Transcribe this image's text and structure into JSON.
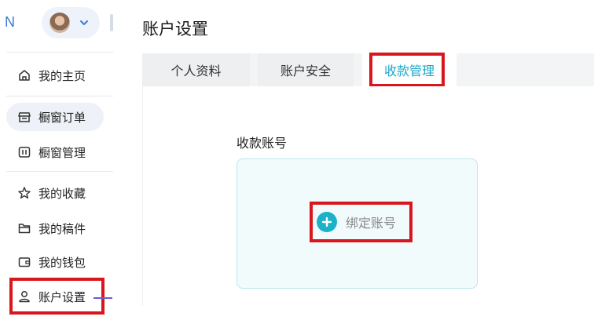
{
  "header": {
    "brand_letter": "N"
  },
  "sidebar": {
    "items": [
      {
        "label": "我的主页",
        "icon": "home-icon"
      },
      {
        "label": "橱窗订单",
        "icon": "storefront-icon"
      },
      {
        "label": "橱窗管理",
        "icon": "manage-icon"
      },
      {
        "label": "我的收藏",
        "icon": "star-icon"
      },
      {
        "label": "我的稿件",
        "icon": "folder-icon"
      },
      {
        "label": "我的钱包",
        "icon": "wallet-icon"
      },
      {
        "label": "账户设置",
        "icon": "user-icon"
      }
    ]
  },
  "main": {
    "title": "账户设置",
    "tabs": [
      {
        "label": "个人资料"
      },
      {
        "label": "账户安全"
      },
      {
        "label": "收款管理"
      }
    ],
    "section_label": "收款账号",
    "bind_button_label": "绑定账号"
  },
  "colors": {
    "accent": "#1bb1c9",
    "annotation_red": "#d9161d",
    "annotation_arrow": "#6b5bd2",
    "card_border": "#b9e6ee"
  }
}
